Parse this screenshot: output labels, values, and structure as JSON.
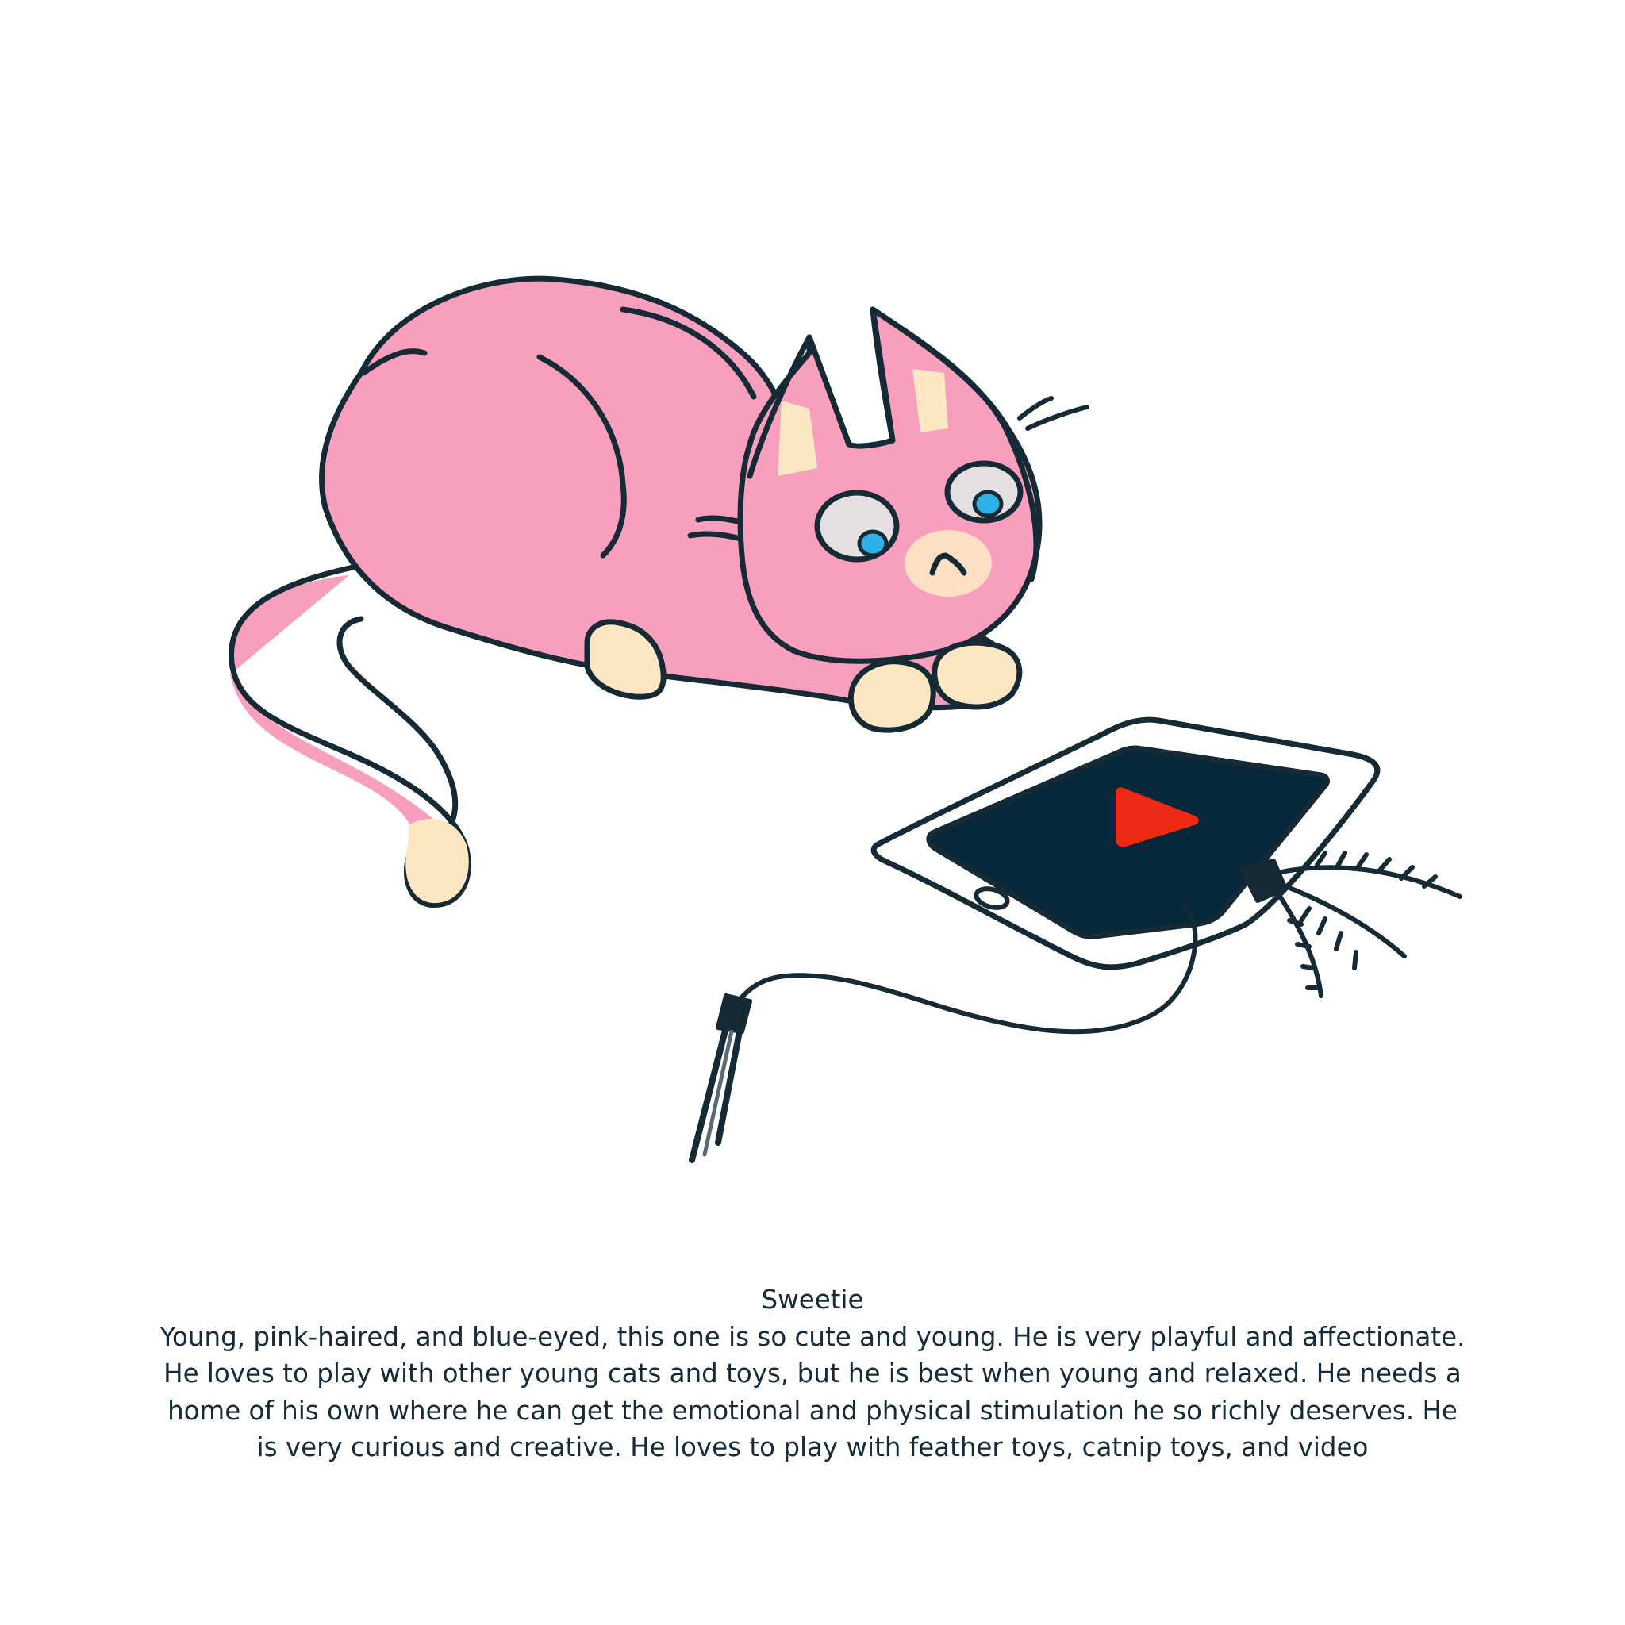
{
  "caption": {
    "name": "Sweetie",
    "description": "Young, pink-haired, and blue-eyed, this one is so cute and young. He is very playful and affectionate. He loves to play with other young cats and toys, but he is best when young and relaxed. He needs a home of his own where he can get the emotional and physical stimulation he so richly deserves. He is very curious and creative. He loves to play with feather toys, catnip toys, and video"
  },
  "colors": {
    "fur": "#f99fbe",
    "cream": "#fde7c3",
    "outline": "#162a36",
    "eye_white": "#e4dfe1",
    "iris": "#2eb1e6",
    "screen": "#07273a",
    "play_button": "#ee2a14",
    "text": "#152b3a"
  },
  "icons": [
    "play-button-icon",
    "home-button-icon"
  ]
}
